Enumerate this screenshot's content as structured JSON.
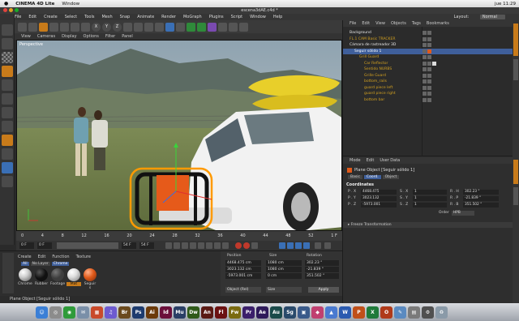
{
  "mac_menubar": {
    "apple": "",
    "app": "CINEMA 4D Lite",
    "menu": [
      "Window"
    ],
    "clock": "jue 11:29"
  },
  "window": {
    "title": "escena3dAE.c4d *"
  },
  "app_menu": {
    "items": [
      "File",
      "Edit",
      "Create",
      "Select",
      "Tools",
      "Mesh",
      "Snap",
      "Animate",
      "Render",
      "MoGraph",
      "Plugins",
      "Script",
      "Window",
      "Help"
    ],
    "layout_label": "Layout:",
    "layout_value": "Normal"
  },
  "viewport": {
    "menu": [
      "View",
      "Cameras",
      "Display",
      "Options",
      "Filter",
      "Panel"
    ],
    "label": "Perspective"
  },
  "toolbar": {
    "axis_labels": [
      "X",
      "Y",
      "Z"
    ]
  },
  "timeline": {
    "ticks": [
      "0",
      "4",
      "8",
      "12",
      "16",
      "20",
      "24",
      "28",
      "32",
      "36",
      "40",
      "44",
      "48",
      "52"
    ],
    "end_label": "1 F"
  },
  "transport": {
    "current": "0 F",
    "min": "0 F",
    "max": "54 F",
    "end": "54 F"
  },
  "materials": {
    "menu": [
      "Create",
      "Edit",
      "Function",
      "Texture"
    ],
    "filters": [
      {
        "label": "All",
        "active": true
      },
      {
        "label": "No Layer",
        "active": false
      },
      {
        "label": "Chrome",
        "active": true
      }
    ],
    "items": [
      {
        "name": "Chrome",
        "color": "#cfcfcf",
        "selected": false
      },
      {
        "name": "Rubber",
        "color": "#111111",
        "selected": false
      },
      {
        "name": "Footage",
        "color": "#3d3d3d",
        "selected": false
      },
      {
        "name": "Mat",
        "color": "#dddddd",
        "selected": true
      },
      {
        "name": "Seguir s",
        "color": "#e05a1a",
        "selected": false
      }
    ]
  },
  "coordinates": {
    "headers": {
      "position": "Position",
      "size": "Size",
      "rotation": "Rotation"
    },
    "position": [
      "4468.475 cm",
      "3023.132 cm",
      "-5973.001 cm"
    ],
    "size": [
      "1080 cm",
      "1080 cm",
      "0 cm"
    ],
    "rotation": [
      "302.23 °",
      "-21.839 °",
      "351.502 °"
    ],
    "mode": "Object (Rel)",
    "size_mode": "Size",
    "apply": "Apply"
  },
  "status_bar": "Plane Object [Seguir sólido 1]",
  "object_manager": {
    "menu": [
      "File",
      "Edit",
      "View",
      "Objects",
      "Tags",
      "Bookmarks"
    ],
    "objects": [
      {
        "name": "Background",
        "color": "#e8e8e8",
        "indent": 0
      },
      {
        "name": "FL.1 CAM Basic TRACKER",
        "color": "#d2a020",
        "indent": 0
      },
      {
        "name": "Cámara de rastreador 3D",
        "color": "#e8e8e8",
        "indent": 0
      },
      {
        "name": "Seguir sólido 1",
        "color": "#ffffff",
        "indent": 1,
        "selected": true
      },
      {
        "name": "Grill Guard",
        "color": "#d2a020",
        "indent": 2
      },
      {
        "name": "Car Reflector",
        "color": "#d2a020",
        "indent": 3
      },
      {
        "name": "Sentido NURBS",
        "color": "#d2a020",
        "indent": 3
      },
      {
        "name": "Grille Guard",
        "color": "#d2a020",
        "indent": 3
      },
      {
        "name": "bottom_rails",
        "color": "#d2a020",
        "indent": 3
      },
      {
        "name": "guard piece left",
        "color": "#d2a020",
        "indent": 3
      },
      {
        "name": "guard piece right",
        "color": "#d2a020",
        "indent": 3
      },
      {
        "name": "bottom bar",
        "color": "#d2a020",
        "indent": 3
      }
    ]
  },
  "attributes": {
    "menu": [
      "Mode",
      "Edit",
      "User Data"
    ],
    "title": "Plane Object [Seguir sólido 1]",
    "tabs": [
      {
        "label": "Basic",
        "active": false
      },
      {
        "label": "Coord.",
        "active": true
      },
      {
        "label": "Object",
        "active": false
      }
    ],
    "section": "Coordinates",
    "rows": [
      {
        "p": "P . X",
        "pv": "4468.475 ",
        "s": "S . X",
        "sv": "1",
        "r": "R . H",
        "rv": "302.23 °"
      },
      {
        "p": "P . Y",
        "pv": "3023.132 ",
        "s": "S . Y",
        "sv": "1",
        "r": "R . P",
        "rv": "-21.839 °"
      },
      {
        "p": "P . Z",
        "pv": "-5973.001 ",
        "s": "S . Z",
        "sv": "1",
        "r": "R . B",
        "rv": "351.502 °"
      }
    ],
    "order_label": "Order",
    "order_value": "HPB",
    "freeze": "Freeze Transformation"
  },
  "dock": [
    {
      "label": "☺",
      "color": "#3b7fd6"
    },
    {
      "label": "◎",
      "color": "#8c8c8c"
    },
    {
      "label": "◉",
      "color": "#2f9b3a"
    },
    {
      "label": "✉",
      "color": "#7a8fa8"
    },
    {
      "label": "▦",
      "color": "#c94a2b"
    },
    {
      "label": "♫",
      "color": "#6d5bd0"
    },
    {
      "label": "Br",
      "color": "#6b4a1e"
    },
    {
      "label": "Ps",
      "color": "#1d3b6e"
    },
    {
      "label": "Ai",
      "color": "#6b3a0a"
    },
    {
      "label": "Id",
      "color": "#6b0f3b"
    },
    {
      "label": "Mu",
      "color": "#2a3f66"
    },
    {
      "label": "Dw",
      "color": "#2f5a1a"
    },
    {
      "label": "An",
      "color": "#5a1a14"
    },
    {
      "label": "Fl",
      "color": "#6b1111"
    },
    {
      "label": "Fw",
      "color": "#7a6a10"
    },
    {
      "label": "Pr",
      "color": "#3b1f6b"
    },
    {
      "label": "Ae",
      "color": "#2e1a5a"
    },
    {
      "label": "Au",
      "color": "#1a4a4a"
    },
    {
      "label": "Sg",
      "color": "#2a4a6b"
    },
    {
      "label": "▣",
      "color": "#3a5a8a"
    },
    {
      "label": "◆",
      "color": "#c04070"
    },
    {
      "label": "▲",
      "color": "#4a7ad0"
    },
    {
      "label": "W",
      "color": "#2a5ab0"
    },
    {
      "label": "P",
      "color": "#c0501a"
    },
    {
      "label": "X",
      "color": "#1f7a3a"
    },
    {
      "label": "O",
      "color": "#b03a1a"
    },
    {
      "label": "✎",
      "color": "#5a8ac0"
    },
    {
      "label": "▤",
      "color": "#7a7a7a"
    },
    {
      "label": "⚙",
      "color": "#505050"
    },
    {
      "label": "♻",
      "color": "#8a9aa8"
    }
  ],
  "colors": {
    "accent_orange": "#c87b1a",
    "selection_blue": "#3f5f9b"
  }
}
